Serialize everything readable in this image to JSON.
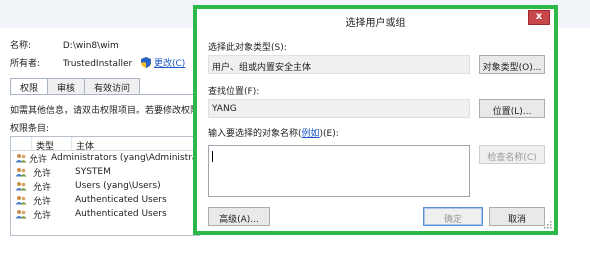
{
  "background_window": {
    "name_label": "名称:",
    "name_value": "D:\\win8\\wim",
    "owner_label": "所有者:",
    "owner_value": "TrustedInstaller",
    "change_link": "更改(C)",
    "tabs": [
      "权限",
      "审核",
      "有效访问"
    ],
    "info_text": "如需其他信息，请双击权限项目。若要修改权限",
    "entries_label": "权限条目:",
    "table_headers": [
      "类型",
      "主体"
    ],
    "rows": [
      {
        "type": "允许",
        "principal": "Administrators (yang\\Administrat"
      },
      {
        "type": "允许",
        "principal": "SYSTEM"
      },
      {
        "type": "允许",
        "principal": "Users (yang\\Users)"
      },
      {
        "type": "允许",
        "principal": "Authenticated Users"
      },
      {
        "type": "允许",
        "principal": "Authenticated Users"
      }
    ]
  },
  "dialog": {
    "title": "选择用户或组",
    "close_label": "x",
    "object_type_label": "选择此对象类型(S):",
    "object_type_value": "用户、组或内置安全主体",
    "object_types_button": "对象类型(O)...",
    "location_label": "查找位置(F):",
    "location_value": "YANG",
    "locations_button": "位置(L)...",
    "enter_names_label_prefix": "输入要选择的对象名称(",
    "enter_names_link": "例如",
    "enter_names_label_suffix": ")(E):",
    "check_names_button": "检查名称(C)",
    "advanced_button": "高级(A)...",
    "ok_button": "确定",
    "cancel_button": "取消"
  },
  "colors": {
    "highlight_border": "#2db84a",
    "close_button": "#c7474a",
    "link": "#1a56c9"
  }
}
